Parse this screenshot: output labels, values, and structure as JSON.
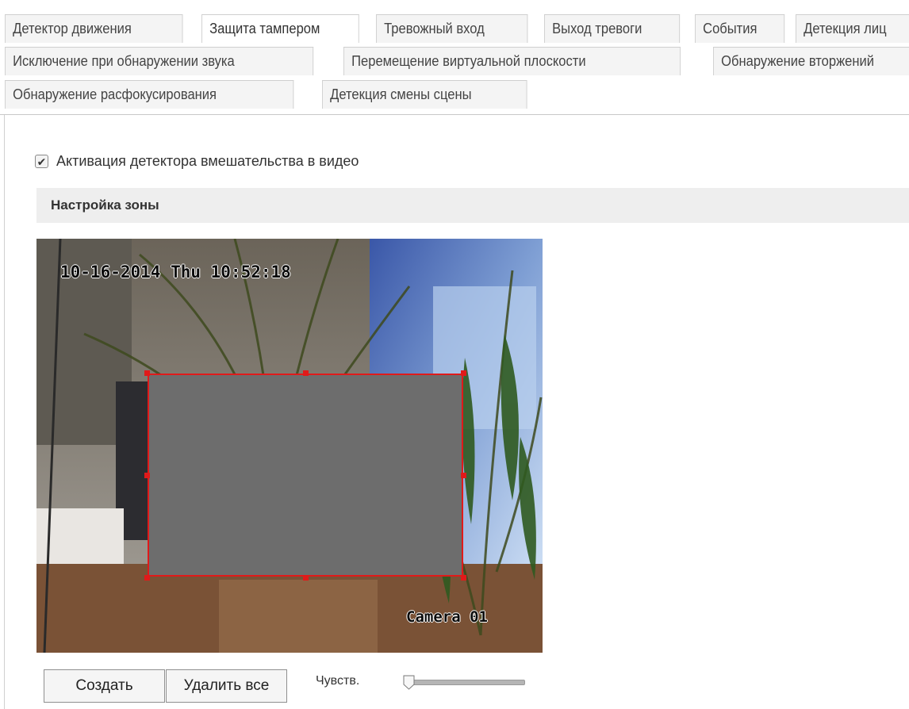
{
  "tabs": {
    "row1": [
      {
        "label": "Детектор движения",
        "active": false
      },
      {
        "label": "Защита тампером",
        "active": true
      },
      {
        "label": "Тревожный вход",
        "active": false
      },
      {
        "label": "Выход тревоги",
        "active": false
      },
      {
        "label": "События",
        "active": false
      },
      {
        "label": "Детекция лиц",
        "active": false
      }
    ],
    "row2": [
      {
        "label": "Исключение при обнаружении звука",
        "active": false
      },
      {
        "label": "Перемещение виртуальной плоскости",
        "active": false
      },
      {
        "label": "Обнаружение вторжений",
        "active": false
      }
    ],
    "row3": [
      {
        "label": "Обнаружение расфокусирования",
        "active": false
      },
      {
        "label": "Детекция смены сцены",
        "active": false
      }
    ]
  },
  "enable": {
    "label": "Активация детектора вмешательства в видео",
    "checked": true
  },
  "area": {
    "title": "Настройка зоны"
  },
  "video": {
    "timestamp": "10-16-2014 Thu 10:52:18",
    "camera_name": "Camera 01"
  },
  "controls": {
    "create_label": "Создать",
    "delete_all_label": "Удалить все",
    "sensitivity_label": "Чувств.",
    "sensitivity_value": 0
  },
  "colors": {
    "mask_border": "#e01a1a",
    "mask_fill": "#6d6d6d",
    "section_bg": "#eeeeee"
  },
  "icons": {
    "checkbox": "checkmark-icon"
  }
}
